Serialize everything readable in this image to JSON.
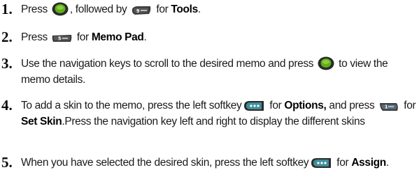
{
  "steps": [
    {
      "number": "1.",
      "parts": {
        "a": "Press",
        "b": ", followed by",
        "c": "for",
        "d": "Tools",
        "e": "."
      },
      "icons": [
        "ok-menu-key-icon",
        "9-wxyz-key-icon"
      ]
    },
    {
      "number": "2.",
      "parts": {
        "a": "Press",
        "b": "for",
        "c": "Memo Pad",
        "d": "."
      },
      "icons": [
        "5-jkl-key-icon"
      ]
    },
    {
      "number": "3.",
      "parts": {
        "a": "Use the navigation keys to scroll to the desired memo and press",
        "b": "to view the memo details."
      },
      "icons": [
        "ok-menu-key-icon"
      ]
    },
    {
      "number": "4.",
      "parts": {
        "a": "To add a skin to the memo, press the left softkey",
        "b": "for",
        "c": "Options,",
        "d": "and press",
        "e": "for",
        "f": "Set Skin",
        "g": ".Press the navigation key left and right to display the different skins"
      },
      "icons": [
        "left-softkey-icon",
        "1-key-icon"
      ]
    },
    {
      "number": "5.",
      "parts": {
        "a": "When you have selected the desired skin, press the left softkey",
        "b": "for",
        "c": "Assign",
        "d": "."
      },
      "icons": [
        "left-softkey-icon"
      ]
    }
  ],
  "colors": {
    "text": "#1a1a1a",
    "key_dark": "#3a3a3a",
    "key_green": "#7cc11f"
  }
}
